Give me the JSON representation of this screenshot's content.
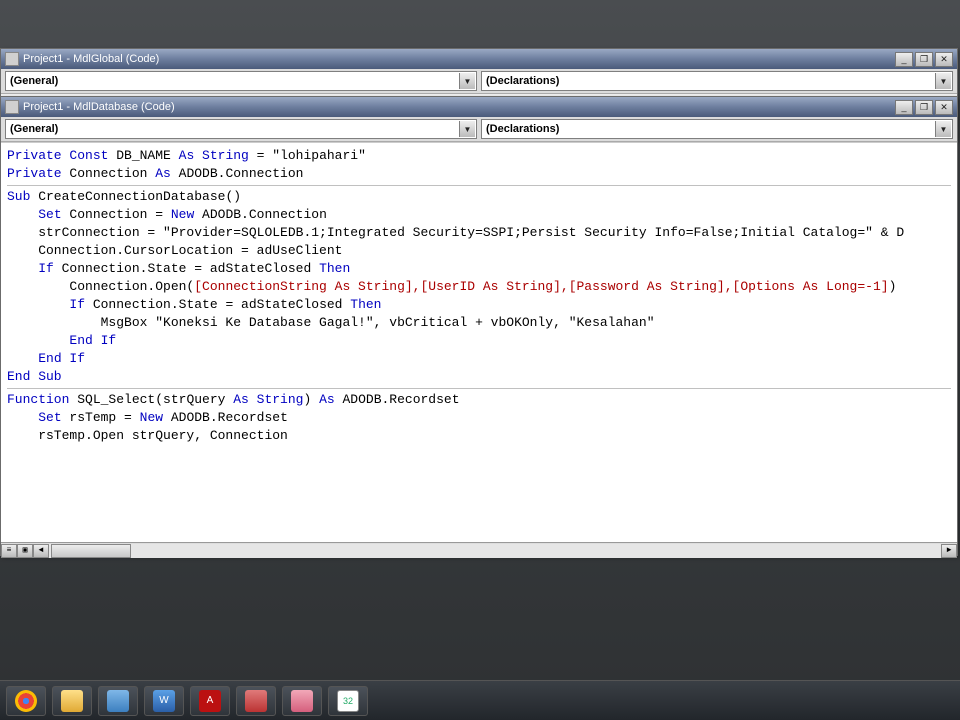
{
  "windows": {
    "global": {
      "title": "Project1 - MdlGlobal (Code)",
      "object_dropdown": "(General)",
      "proc_dropdown": "(Declarations)"
    },
    "database": {
      "title": "Project1 - MdlDatabase (Code)",
      "object_dropdown": "(General)",
      "proc_dropdown": "(Declarations)"
    }
  },
  "code": {
    "l1_a": "Private Const",
    "l1_b": " DB_NAME ",
    "l1_c": "As String",
    "l1_d": " = \"lohipahari\"",
    "l2_a": "Private",
    "l2_b": " Connection ",
    "l2_c": "As",
    "l2_d": " ADODB.Connection",
    "l3": "",
    "l4_a": "Sub",
    "l4_b": " CreateConnectionDatabase()",
    "l5_a": "    ",
    "l5_b": "Set",
    "l5_c": " Connection = ",
    "l5_d": "New",
    "l5_e": " ADODB.Connection",
    "l6": "    strConnection = \"Provider=SQLOLEDB.1;Integrated Security=SSPI;Persist Security Info=False;Initial Catalog=\" & D",
    "l7": "    Connection.CursorLocation = adUseClient",
    "l8_a": "    ",
    "l8_b": "If",
    "l8_c": " Connection.State = adStateClosed ",
    "l8_d": "Then",
    "l9_a": "        Connection.Open(",
    "l9_b": "[ConnectionString As String],[UserID As String],[Password As String],[Options As Long=-1]",
    "l9_c": ")",
    "l10": "",
    "l11_a": "        ",
    "l11_b": "If",
    "l11_c": " Connection.State = adStateClosed ",
    "l11_d": "Then",
    "l12": "            MsgBox \"Koneksi Ke Database Gagal!\", vbCritical + vbOKOnly, \"Kesalahan\"",
    "l13_a": "        ",
    "l13_b": "End If",
    "l14_a": "    ",
    "l14_b": "End If",
    "l15": "End Sub",
    "l16": "",
    "l17_a": "Function",
    "l17_b": " SQL_Select(strQuery ",
    "l17_c": "As String",
    "l17_d": ") ",
    "l17_e": "As",
    "l17_f": " ADODB.Recordset",
    "l18_a": "    ",
    "l18_b": "Set",
    "l18_c": " rsTemp = ",
    "l18_d": "New",
    "l18_e": " ADODB.Recordset",
    "l19": "    rsTemp.Open strQuery, Connection"
  },
  "window_controls": {
    "min": "_",
    "max": "❐",
    "close": "✕",
    "restore": "❐"
  },
  "taskbar": {
    "word_label": "W",
    "pdf_label": "A",
    "px_label": "32"
  }
}
